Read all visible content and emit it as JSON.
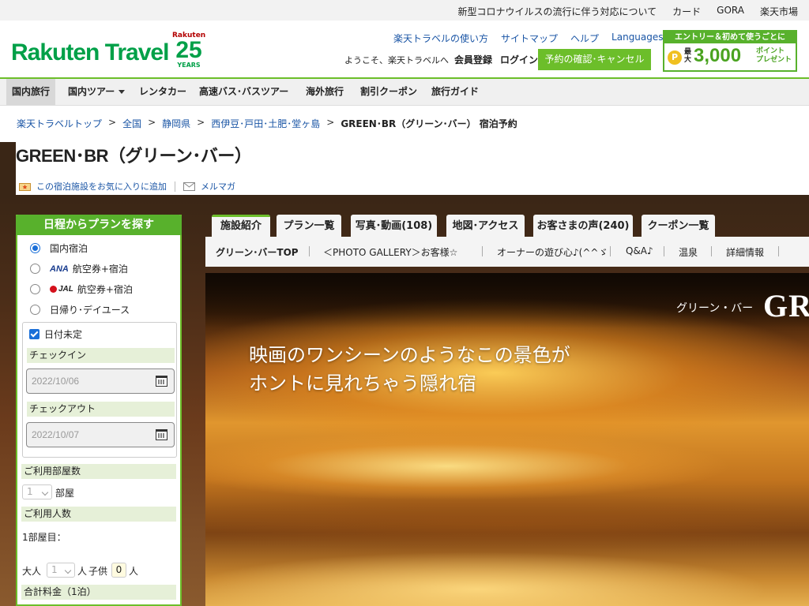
{
  "topbar": {
    "links": [
      "新型コロナウイルスの流行に伴う対応について",
      "カード",
      "GORA",
      "楽天市場"
    ]
  },
  "header": {
    "logo": "Rakuten Travel",
    "anniv_brand": "Rakuten",
    "anniv_num": "25",
    "anniv_years": "YEARS",
    "links": [
      "楽天トラベルの使い方",
      "サイトマップ",
      "ヘルプ",
      "Languages"
    ],
    "welcome": "ようこそ、楽天トラベルへ",
    "member": "会員登録",
    "login": "ログイン",
    "reserve": "予約の確認･キャンセル",
    "promo_top": "エントリー＆初めて使うごとに",
    "promo_coin": "P",
    "promo_max": "最大",
    "promo_big": "3,000",
    "promo_pt1": "ポイント",
    "promo_pt2": "プレゼント"
  },
  "gnav": [
    "国内旅行",
    "国内ツアー",
    "レンタカー",
    "高速バス･バスツアー",
    "海外旅行",
    "割引クーポン",
    "旅行ガイド"
  ],
  "breadcrumb": {
    "items": [
      "楽天トラベルトップ",
      "全国",
      "静岡県",
      "西伊豆･戸田･土肥･堂ヶ島"
    ],
    "sep": ">",
    "current": "GREEN･BR（グリーン･バー） 宿泊予約"
  },
  "hotel": {
    "title": "GREEN･BR（グリーン･バー）",
    "fav": "この宿泊施設をお気に入りに追加",
    "mail": "メルマガ"
  },
  "search": {
    "head": "日程からプランを探す",
    "options": [
      "国内宿泊",
      "航空券+宿泊",
      "航空券+宿泊",
      "日帰り･デイユース"
    ],
    "ana": "ANA",
    "jal": "JAL",
    "undecided": "日付未定",
    "checkin_label": "チェックイン",
    "checkin_value": "2022/10/06",
    "checkout_label": "チェックアウト",
    "checkout_value": "2022/10/07",
    "rooms_label": "ご利用部屋数",
    "rooms_value": "1",
    "rooms_unit": "部屋",
    "people_label": "ご利用人数",
    "room1": "1部屋目：",
    "adult_label": "大人",
    "adult_value": "1",
    "adult_unit": "人",
    "child_label": "子供",
    "child_value": "0",
    "child_unit": "人",
    "total_label": "合計料金（1泊）"
  },
  "tabs": [
    "施設紹介",
    "プラン一覧",
    "写真･動画(108)",
    "地図･アクセス",
    "お客さまの声(240)",
    "クーポン一覧"
  ],
  "subnav": [
    "グリーン･バーTOP",
    "＜PHOTO GALLERY＞お客様☆",
    "オーナーの遊び心♪(^^ゞ",
    "Q&A♪",
    "温泉",
    "詳細情報"
  ],
  "hero": {
    "name": "グリーン・バー",
    "logo": "GR",
    "copy1": "映画のワンシーンのようなこの景色が",
    "copy2": "ホントに見れちゃう隠れ宿"
  },
  "colors": {
    "brand_green": "#00a048",
    "accent_green": "#6cbe2a",
    "link_blue": "#1a55a5"
  }
}
